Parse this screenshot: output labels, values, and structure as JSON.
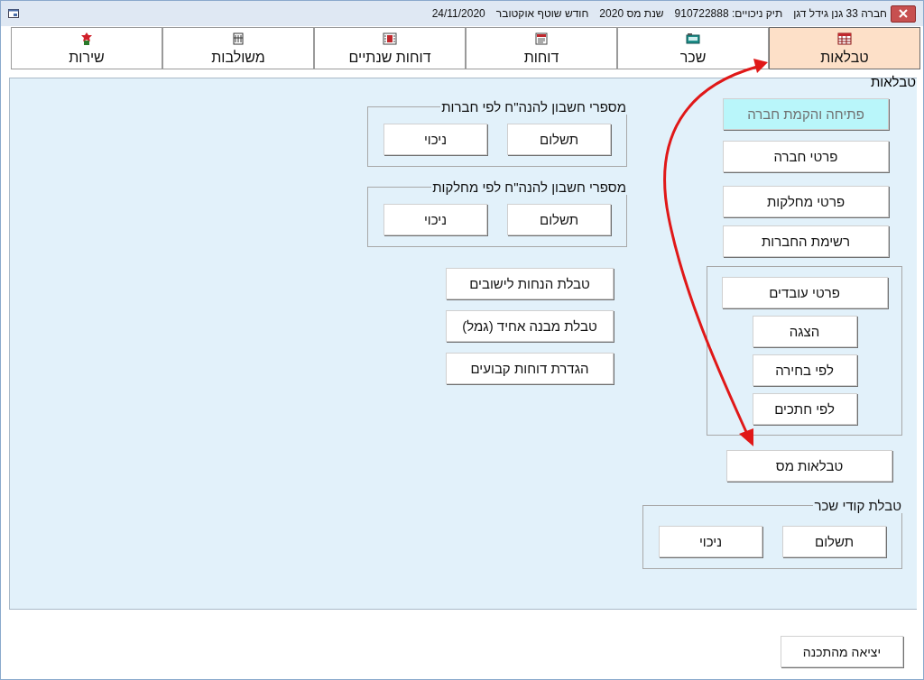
{
  "window": {
    "title_items": [
      "חברה 33 גנן גידל דגן",
      "תיק ניכויים: 910722888",
      "שנת מס 2020",
      "חודש שוטף אוקטובר",
      "24/11/2020"
    ]
  },
  "tabs": [
    {
      "label": "טבלאות",
      "kind": "tables",
      "selected": true
    },
    {
      "label": "שכר",
      "kind": "salary",
      "selected": false
    },
    {
      "label": "דוחות",
      "kind": "reports",
      "selected": false
    },
    {
      "label": "דוחות שנתיים",
      "kind": "annual",
      "selected": false
    },
    {
      "label": "משולבות",
      "kind": "combined",
      "selected": false
    },
    {
      "label": "שירות",
      "kind": "services",
      "selected": false
    }
  ],
  "panel": {
    "title": "טבלאות",
    "company_buttons": [
      {
        "label": "פתיחה והקמת חברה",
        "disabled": true
      },
      {
        "label": "פרטי חברה",
        "disabled": false
      },
      {
        "label": "פרטי מחלקות",
        "disabled": false
      },
      {
        "label": "רשימת החברות",
        "disabled": false
      }
    ],
    "employees_group": {
      "button": "פרטי עובדים",
      "sub_buttons": [
        "הצגה",
        "לפי בחירה",
        "לפי חתכים"
      ]
    },
    "tax_tables_button": "טבלאות מס",
    "salary_codes_group": {
      "title": "טבלת קודי שכר",
      "buttons": [
        "תשלום",
        "ניכוי"
      ]
    },
    "account_groups": [
      {
        "title": "מספרי חשבון להנה\"ח לפי חברות",
        "buttons": [
          "תשלום",
          "ניכוי"
        ]
      },
      {
        "title": "מספרי חשבון להנה\"ח לפי מחלקות",
        "buttons": [
          "תשלום",
          "ניכוי"
        ]
      }
    ],
    "table_buttons": [
      "טבלת הנחות לישובים",
      "טבלת מבנה אחיד (גמל)",
      "הגדרת דוחות קבועים"
    ]
  },
  "exit_button": "יציאה מהתכנה"
}
